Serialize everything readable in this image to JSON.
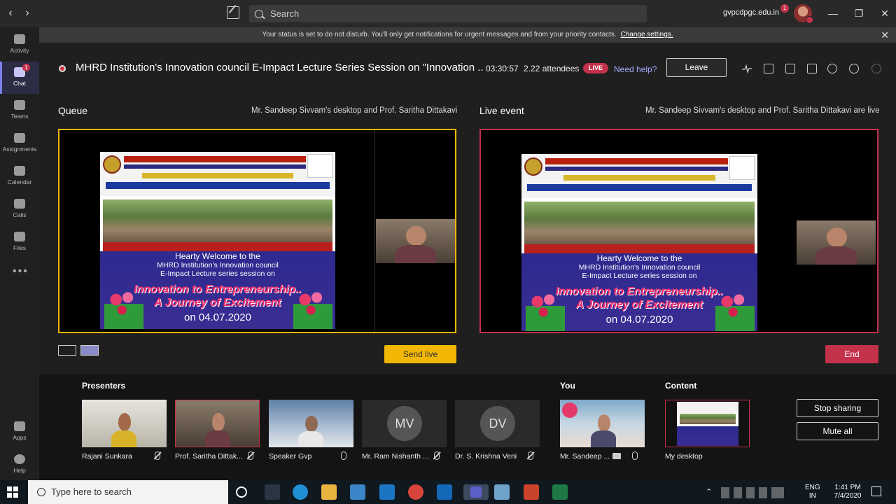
{
  "titlebar": {
    "search_placeholder": "Search",
    "tenant": "gvpcdpgc.edu.in",
    "tenant_badge": "1",
    "minimize": "—",
    "restore": "❐",
    "close": "✕"
  },
  "rail": {
    "items": [
      {
        "label": "Activity"
      },
      {
        "label": "Chat",
        "badge": "1"
      },
      {
        "label": "Teams"
      },
      {
        "label": "Assignments"
      },
      {
        "label": "Calendar"
      },
      {
        "label": "Calls"
      },
      {
        "label": "Files"
      }
    ],
    "more": "•••",
    "apps": "Apps",
    "help": "Help"
  },
  "banner": {
    "text": "Your status is set to do not disturb. You'll only get notifications for urgent messages and from your priority contacts.",
    "link": "Change settings."
  },
  "meeting": {
    "title": "MHRD Institution's Innovation council E-Impact Lecture Series Session on \"Innovation ...",
    "timer": "03:30:57",
    "attendees": "2.22 attendees",
    "live_badge": "LIVE",
    "help": "Need help?",
    "leave": "Leave"
  },
  "queue": {
    "label": "Queue",
    "caption": "Mr. Sandeep Sivvam's desktop and Prof. Saritha Dittakavi",
    "send_live": "Send live"
  },
  "live": {
    "label": "Live event",
    "caption": "Mr. Sandeep Sivvam's desktop and Prof. Saritha Dittakavi are live",
    "end": "End"
  },
  "slide": {
    "welcome_line1": "Hearty Welcome to the",
    "welcome_line2": "MHRD Institution's Innovation council",
    "welcome_line3": "E-Impact Lecture series session on",
    "innovation_line1": "Innovation to Entrepreneurship..",
    "innovation_line2": "A Journey of Excitement",
    "date": "on 04.07.2020"
  },
  "presenters": {
    "section_label": "Presenters",
    "you_label": "You",
    "content_label": "Content",
    "tiles": [
      {
        "name": "Rajani Sunkara"
      },
      {
        "name": "Prof. Saritha Dittak..."
      },
      {
        "name": "Speaker Gvp"
      },
      {
        "name": "Mr. Ram Nishanth ...",
        "initials": "MV"
      },
      {
        "name": "Dr. S. Krishna Veni",
        "initials": "DV"
      }
    ],
    "you_name": "Mr. Sandeep ...",
    "content_name": "My desktop",
    "stop_sharing": "Stop sharing",
    "mute_all": "Mute all"
  },
  "taskbar": {
    "search_placeholder": "Type here to search",
    "lang_line1": "ENG",
    "lang_line2": "IN",
    "time": "1:41 PM",
    "date": "7/4/2020"
  },
  "colors": {
    "queue_border": "#f2b705",
    "live_border": "#c4314b",
    "accent": "#7b83eb"
  }
}
